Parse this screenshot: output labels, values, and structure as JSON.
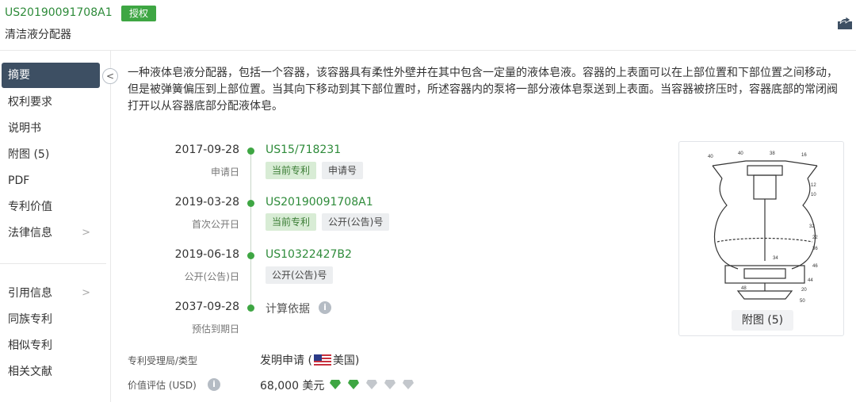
{
  "header": {
    "pub_number": "US20190091708A1",
    "status": "授权",
    "title": "清洁液分配器"
  },
  "sidebar": {
    "items": [
      {
        "label": "摘要",
        "active": true
      },
      {
        "label": "权利要求"
      },
      {
        "label": "说明书"
      },
      {
        "label": "附图 (5)"
      },
      {
        "label": "PDF"
      },
      {
        "label": "专利价值"
      },
      {
        "label": "法律信息",
        "chevron": true
      }
    ],
    "items2": [
      {
        "label": "引用信息",
        "chevron": true
      },
      {
        "label": "同族专利"
      },
      {
        "label": "相似专利"
      },
      {
        "label": "相关文献"
      }
    ]
  },
  "abstract": "一种液体皂液分配器，包括一个容器，该容器具有柔性外壁并在其中包含一定量的液体皂液。容器的上表面可以在上部位置和下部位置之间移动，但是被弹簧偏压到上部位置。当其向下移动到其下部位置时，所述容器内的泵将一部分液体皂泵送到上表面。当容器被挤压时，容器底部的常闭阀打开以从容器底部分配液体皂。",
  "timeline": [
    {
      "date": "2017-09-28",
      "label": "申请日",
      "number": "US15/718231",
      "tags": [
        "当前专利",
        "申请号"
      ]
    },
    {
      "date": "2019-03-28",
      "label": "首次公开日",
      "number": "US20190091708A1",
      "tags": [
        "当前专利",
        "公开(公告)号"
      ]
    },
    {
      "date": "2019-06-18",
      "label": "公开(公告)日",
      "number": "US10322427B2",
      "tags": [
        "公开(公告)号"
      ]
    },
    {
      "date": "2037-09-28",
      "label": "预估到期日",
      "number": "计算依据",
      "tags": []
    }
  ],
  "meta": {
    "office_label": "专利受理局/类型",
    "office_value_pre": "发明申请 (",
    "office_country": "美国)",
    "value_label": "价值评估 (USD)",
    "value_amount": "68,000 美元",
    "value_rating": 2,
    "value_rating_max": 5
  },
  "figure": {
    "button_label": "附图 (5)"
  },
  "colors": {
    "accent_green": "#3ea643",
    "nav_active": "#3d4f63"
  },
  "icons": [
    "share-icon",
    "collapse-left-icon",
    "info-icon",
    "us-flag-icon",
    "gem-icon"
  ]
}
